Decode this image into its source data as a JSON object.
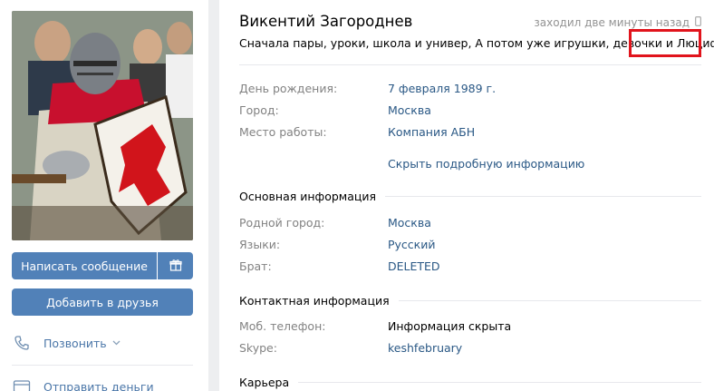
{
  "profile": {
    "name": "Викентий Загороднев",
    "last_seen": "заходил две минуты назад",
    "status": "Сначала пары, уроки, школа и универ, А потом уже игрушки, девочки и Люцифер."
  },
  "actions": {
    "message": "Написать сообщение",
    "add_friend": "Добавить в друзья",
    "call": "Позвонить",
    "send_money": "Отправить деньги"
  },
  "info": {
    "birthday_label": "День рождения:",
    "birthday_value": "7 февраля 1989 г.",
    "city_label": "Город:",
    "city_value": "Москва",
    "work_label": "Место работы:",
    "work_value": "Компания АБН",
    "hide_link": "Скрыть подробную информацию"
  },
  "main_info": {
    "header": "Основная информация",
    "hometown_label": "Родной город:",
    "hometown_value": "Москва",
    "languages_label": "Языки:",
    "languages_value": "Русский",
    "brother_label": "Брат:",
    "brother_value": "DELETED"
  },
  "contact_info": {
    "header": "Контактная информация",
    "phone_label": "Моб. телефон:",
    "phone_value": "Информация скрыта",
    "skype_label": "Skype:",
    "skype_value": "keshfebruary"
  },
  "career": {
    "header": "Карьера"
  },
  "colors": {
    "accent": "#5181b8",
    "link": "#2a5885",
    "highlight": "#e1141c"
  }
}
